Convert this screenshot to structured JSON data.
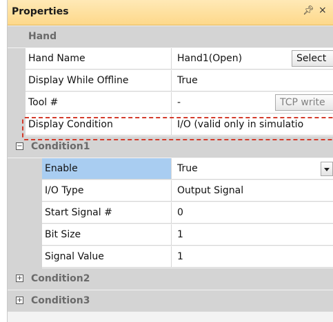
{
  "panel": {
    "title": "Properties",
    "pin_glyph": "1",
    "close_glyph": "×"
  },
  "hand": {
    "category": "Hand",
    "rows": [
      {
        "name": "Hand Name",
        "value": "Hand1(Open)",
        "button": "Select"
      },
      {
        "name": "Display While Offline",
        "value": "True"
      },
      {
        "name": "Tool #",
        "value": "-",
        "button": "TCP write"
      },
      {
        "name": "Display Condition",
        "value": "I/O (valid only in simulatio"
      }
    ]
  },
  "condition1": {
    "category": "Condition1",
    "toggle": "−",
    "rows": [
      {
        "name": "Enable",
        "value": "True"
      },
      {
        "name": "I/O Type",
        "value": "Output Signal"
      },
      {
        "name": "Start Signal #",
        "value": "0"
      },
      {
        "name": "Bit Size",
        "value": "1"
      },
      {
        "name": "Signal Value",
        "value": "1"
      }
    ]
  },
  "condition2": {
    "category": "Condition2",
    "toggle": "+"
  },
  "condition3": {
    "category": "Condition3",
    "toggle": "+"
  },
  "colors": {
    "title_bar": "#fdd88a",
    "selected_row": "#a9cdf1",
    "highlight_dash": "#d33a2a"
  }
}
